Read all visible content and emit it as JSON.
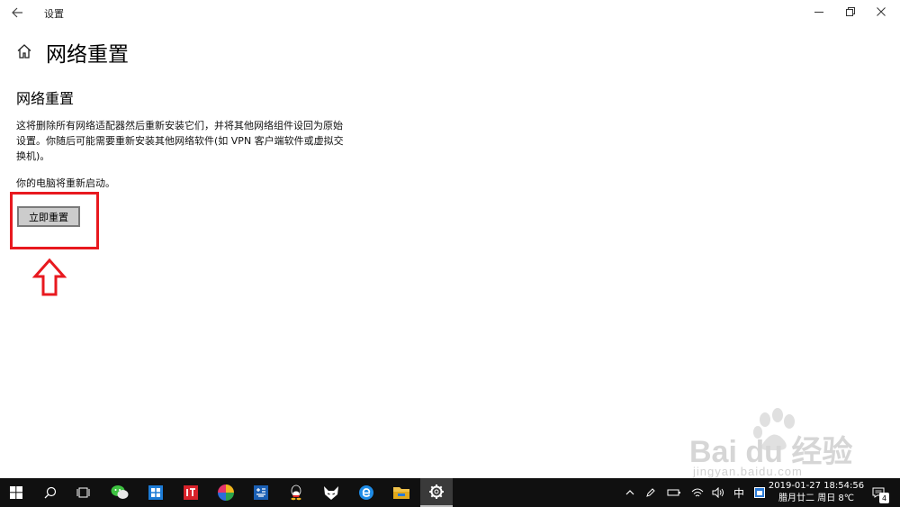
{
  "window": {
    "title": "设置",
    "back_icon": "back-arrow-icon",
    "controls": [
      "minimize-icon",
      "maximize-icon",
      "close-icon"
    ]
  },
  "header": {
    "home_icon": "home-icon",
    "title": "网络重置"
  },
  "main": {
    "section_title": "网络重置",
    "description": "这将删除所有网络适配器然后重新安装它们，并将其他网络组件设回为原始设置。你随后可能需要重新安装其他网络软件(如 VPN 客户端软件或虚拟交换机)。",
    "restart_note": "你的电脑将重新启动。",
    "reset_button_label": "立即重置"
  },
  "annotation": {
    "color": "#e8191f",
    "shapes": [
      "highlight-box",
      "up-arrow-icon"
    ]
  },
  "watermark": {
    "main": "Bai  du 经验",
    "sub": "jingyan.baidu.com"
  },
  "taskbar": {
    "apps": [
      "windows-start-icon",
      "search-icon",
      "task-view-icon",
      "wechat-icon",
      "outlook-icon",
      "it-app-icon",
      "color-wheel-app-icon",
      "chinese-app-icon",
      "qq-icon",
      "fox-app-icon",
      "ie-browser-icon",
      "file-explorer-icon",
      "settings-gear-icon"
    ],
    "active_app": "settings-gear-icon",
    "tray": {
      "ime": "中",
      "date": "2019-01-27",
      "time": "18:54:56",
      "lunar": "腊月廿二 周日 8℃",
      "notification_count": "4"
    }
  },
  "colors": {
    "background": "#ffffff",
    "taskbar": "#101010",
    "button_bg": "#cccccc",
    "button_border": "#7a7a7a",
    "annotation_red": "#e8191f"
  }
}
